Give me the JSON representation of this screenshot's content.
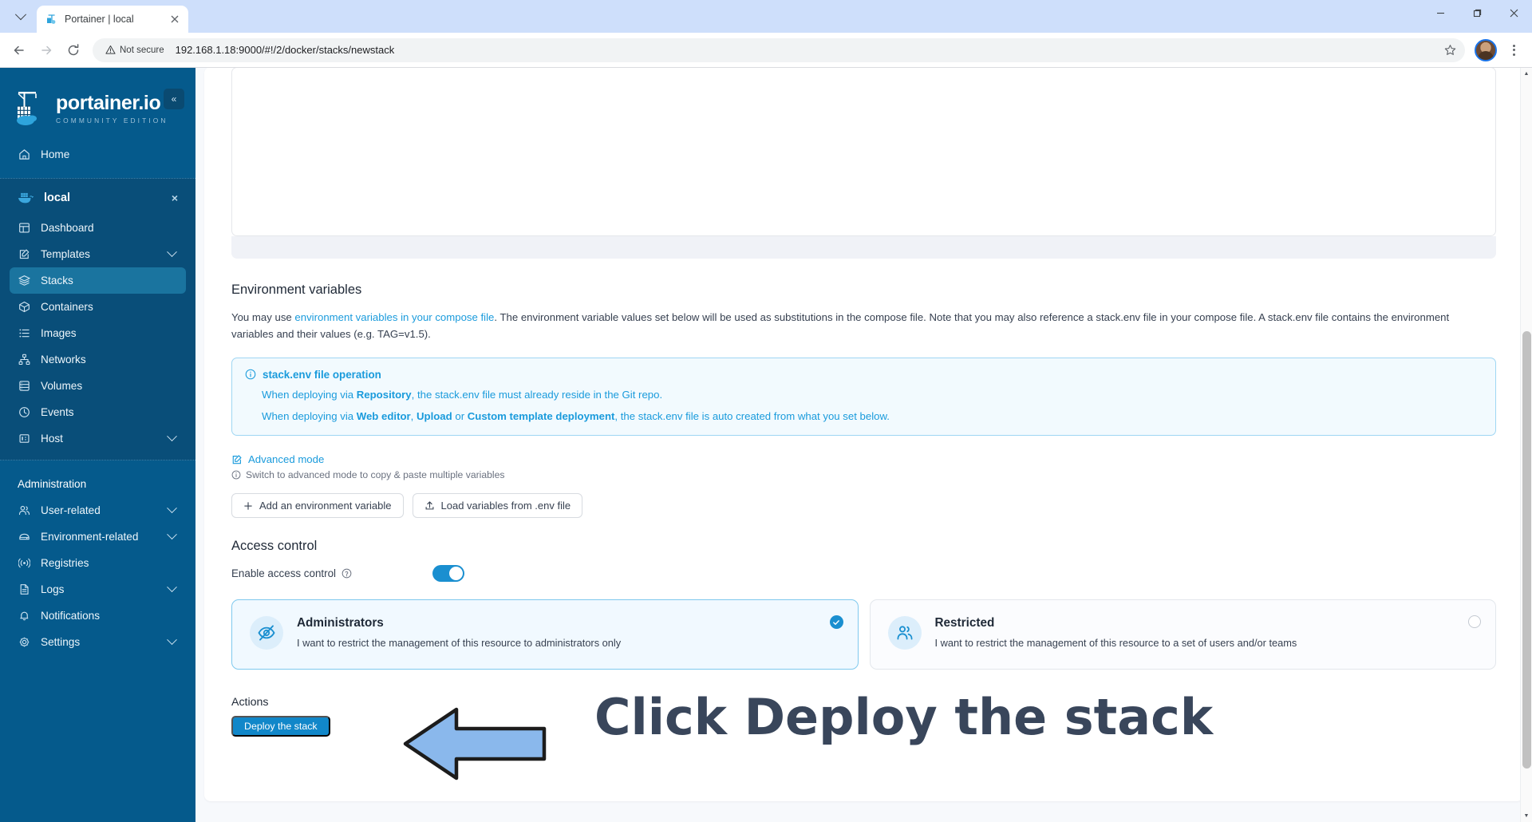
{
  "browser": {
    "tab": {
      "title": "Portainer | local",
      "favicon_icon": "portainer-favicon",
      "close_icon": "close-icon"
    },
    "tab_list_icon": "chevron-down-icon",
    "window_controls": {
      "minimize": "–",
      "maximize": "❐",
      "close": "✕"
    },
    "nav": {
      "back_icon": "arrow-left-icon",
      "forward_icon": "arrow-right-icon",
      "reload_icon": "reload-icon"
    },
    "omnibox": {
      "security_label": "Not secure",
      "security_icon": "warning-triangle-icon",
      "url": "192.168.1.18:9000/#!/2/docker/stacks/newstack",
      "bookmark_icon": "star-icon"
    },
    "profile_icon": "account-avatar",
    "menu_icon": "kebab-menu-icon"
  },
  "sidebar": {
    "brand": {
      "name": "portainer.io",
      "subtitle": "COMMUNITY EDITION",
      "logo_icon": "portainer-logo"
    },
    "collapse_icon": "«",
    "home": {
      "label": "Home",
      "icon": "home-icon"
    },
    "environment": {
      "label": "local",
      "icon": "docker-whale-icon",
      "close_icon": "×"
    },
    "env_items": [
      {
        "label": "Dashboard",
        "icon": "dashboard-icon",
        "active": false,
        "caret": false
      },
      {
        "label": "Templates",
        "icon": "template-icon",
        "active": false,
        "caret": true
      },
      {
        "label": "Stacks",
        "icon": "layers-icon",
        "active": true,
        "caret": false
      },
      {
        "label": "Containers",
        "icon": "container-icon",
        "active": false,
        "caret": false
      },
      {
        "label": "Images",
        "icon": "images-list-icon",
        "active": false,
        "caret": false
      },
      {
        "label": "Networks",
        "icon": "network-icon",
        "active": false,
        "caret": false
      },
      {
        "label": "Volumes",
        "icon": "database-icon",
        "active": false,
        "caret": false
      },
      {
        "label": "Events",
        "icon": "clock-icon",
        "active": false,
        "caret": false
      },
      {
        "label": "Host",
        "icon": "host-icon",
        "active": false,
        "caret": true
      }
    ],
    "admin_title": "Administration",
    "admin_items": [
      {
        "label": "User-related",
        "icon": "users-icon",
        "caret": true
      },
      {
        "label": "Environment-related",
        "icon": "server-icon",
        "caret": true
      },
      {
        "label": "Registries",
        "icon": "registry-icon",
        "caret": false
      },
      {
        "label": "Logs",
        "icon": "document-icon",
        "caret": true
      },
      {
        "label": "Notifications",
        "icon": "bell-icon",
        "caret": false
      },
      {
        "label": "Settings",
        "icon": "gear-icon",
        "caret": true
      }
    ]
  },
  "main": {
    "env_vars": {
      "heading": "Environment variables",
      "helper_prefix": "You may use ",
      "helper_link": "environment variables in your compose file",
      "helper_suffix": ". The environment variable values set below will be used as substitutions in the compose file. Note that you may also reference a stack.env file in your compose file. A stack.env file contains the environment variables and their values (e.g. TAG=v1.5).",
      "info": {
        "icon": "info-circle-icon",
        "title": "stack.env file operation",
        "line1_a": "When deploying via ",
        "line1_b": "Repository",
        "line1_c": ", the stack.env file must already reside in the Git repo.",
        "line2_a": "When deploying via ",
        "line2_b": "Web editor",
        "line2_c": ", ",
        "line2_d": "Upload",
        "line2_e": " or ",
        "line2_f": "Custom template deployment",
        "line2_g": ", the stack.env file is auto created from what you set below."
      },
      "advanced_mode_label": "Advanced mode",
      "advanced_mode_icon": "edit-square-icon",
      "advanced_note": "Switch to advanced mode to copy & paste multiple variables",
      "advanced_note_icon": "info-circle-icon",
      "add_var_label": "Add an environment variable",
      "add_var_icon": "plus-icon",
      "load_env_label": "Load variables from .env file",
      "load_env_icon": "upload-icon"
    },
    "access_control": {
      "heading": "Access control",
      "toggle_label": "Enable access control",
      "toggle_help_icon": "question-circle-icon",
      "toggle_on": true,
      "options": [
        {
          "title": "Administrators",
          "desc": "I want to restrict the management of this resource to administrators only",
          "icon": "eye-off-icon",
          "selected": true
        },
        {
          "title": "Restricted",
          "desc": "I want to restrict the management of this resource to a set of users and/or teams",
          "icon": "users-group-icon",
          "selected": false
        }
      ]
    },
    "actions": {
      "heading": "Actions",
      "deploy_label": "Deploy the stack"
    },
    "annotation": {
      "text": "Click Deploy the stack",
      "arrow_icon": "left-arrow-annotation",
      "arrow_fill": "#8ab8ec",
      "arrow_stroke": "#1c1c1c",
      "text_color": "#39465b"
    }
  },
  "colors": {
    "sidebar_bg": "#055a8c",
    "sidebar_group_bg": "#094e79",
    "accent": "#1a8fd0",
    "link": "#1a9bdc",
    "page_bg": "#f7f9fc"
  }
}
